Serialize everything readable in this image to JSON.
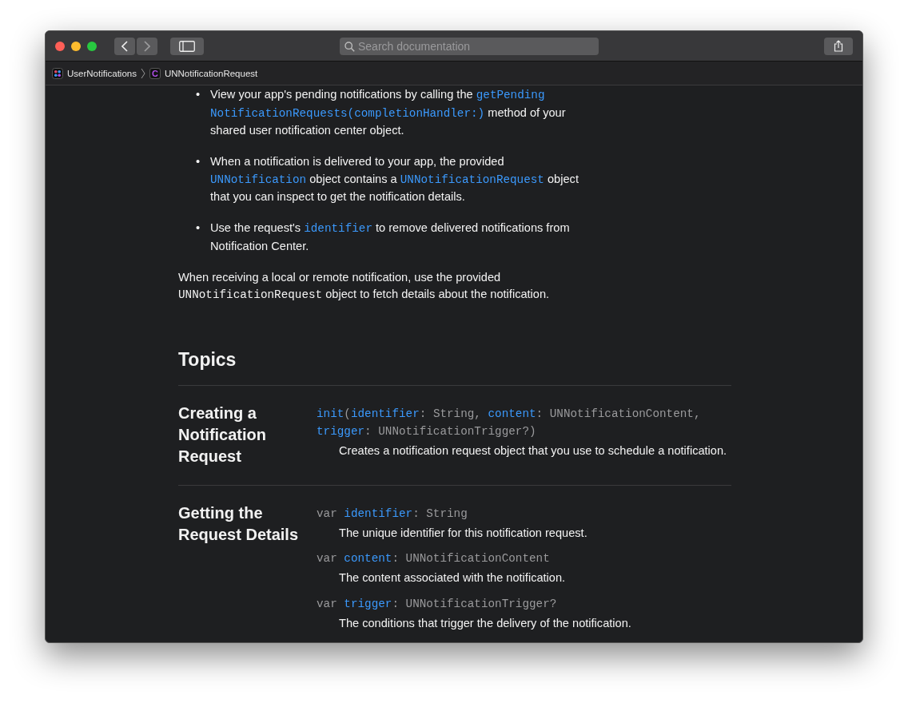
{
  "toolbar": {
    "search": {
      "placeholder": "Search documentation"
    },
    "back_enabled": true,
    "forward_enabled": false
  },
  "breadcrumbs": [
    {
      "kind": "framework",
      "label": "UserNotifications"
    },
    {
      "kind": "class",
      "badge": "C",
      "label": "UNNotificationRequest"
    }
  ],
  "bullets": [
    {
      "marker": "•",
      "segments": [
        {
          "kind": "text",
          "text": "View your app's pending notifications by calling the "
        },
        {
          "kind": "link",
          "text": "getPending"
        },
        {
          "kind": "break"
        },
        {
          "kind": "link",
          "text": "NotificationRequests(completionHandler:)"
        },
        {
          "kind": "text",
          "text": " method of your shared user notification center object."
        }
      ]
    },
    {
      "marker": "•",
      "segments": [
        {
          "kind": "text",
          "text": "When a notification is delivered to your app, the provided "
        },
        {
          "kind": "link",
          "text": "UNNotification"
        },
        {
          "kind": "text",
          "text": " object contains a "
        },
        {
          "kind": "link",
          "text": "UNNotificationRequest"
        },
        {
          "kind": "text",
          "text": " object that you can inspect to get the notification details."
        }
      ]
    },
    {
      "marker": "•",
      "segments": [
        {
          "kind": "text",
          "text": "Use the request's "
        },
        {
          "kind": "link",
          "text": "identifier"
        },
        {
          "kind": "text",
          "text": " to remove delivered notifications from Notification Center."
        }
      ]
    }
  ],
  "paragraph": [
    {
      "kind": "text",
      "text": "When receiving a local or remote notification, use the provided "
    },
    {
      "kind": "code",
      "text": "UNNotificationRequest"
    },
    {
      "kind": "text",
      "text": " object to fetch details about the notification."
    }
  ],
  "topics": {
    "heading": "Topics",
    "groups": [
      {
        "title": "Creating a Notification Request",
        "items": [
          {
            "declaration": [
              {
                "kind": "name",
                "text": "init"
              },
              {
                "kind": "type",
                "text": "("
              },
              {
                "kind": "name",
                "text": "identifier"
              },
              {
                "kind": "type",
                "text": ": String, "
              },
              {
                "kind": "name",
                "text": "content"
              },
              {
                "kind": "type",
                "text": ": UNNotificationContent, "
              },
              {
                "kind": "name",
                "text": "trigger"
              },
              {
                "kind": "type",
                "text": ": UNNotificationTrigger?)"
              }
            ],
            "abstract": "Creates a notification request object that you use to schedule a notification."
          }
        ]
      },
      {
        "title": "Getting the Request Details",
        "items": [
          {
            "declaration": [
              {
                "kind": "type",
                "text": "var "
              },
              {
                "kind": "name",
                "text": "identifier"
              },
              {
                "kind": "type",
                "text": ": String"
              }
            ],
            "abstract": "The unique identifier for this notification request."
          },
          {
            "declaration": [
              {
                "kind": "type",
                "text": "var "
              },
              {
                "kind": "name",
                "text": "content"
              },
              {
                "kind": "type",
                "text": ": UNNotificationContent"
              }
            ],
            "abstract": "The content associated with the notification."
          },
          {
            "declaration": [
              {
                "kind": "type",
                "text": "var "
              },
              {
                "kind": "name",
                "text": "trigger"
              },
              {
                "kind": "type",
                "text": ": UNNotificationTrigger?"
              }
            ],
            "abstract": "The conditions that trigger the delivery of the notification."
          }
        ]
      }
    ]
  }
}
